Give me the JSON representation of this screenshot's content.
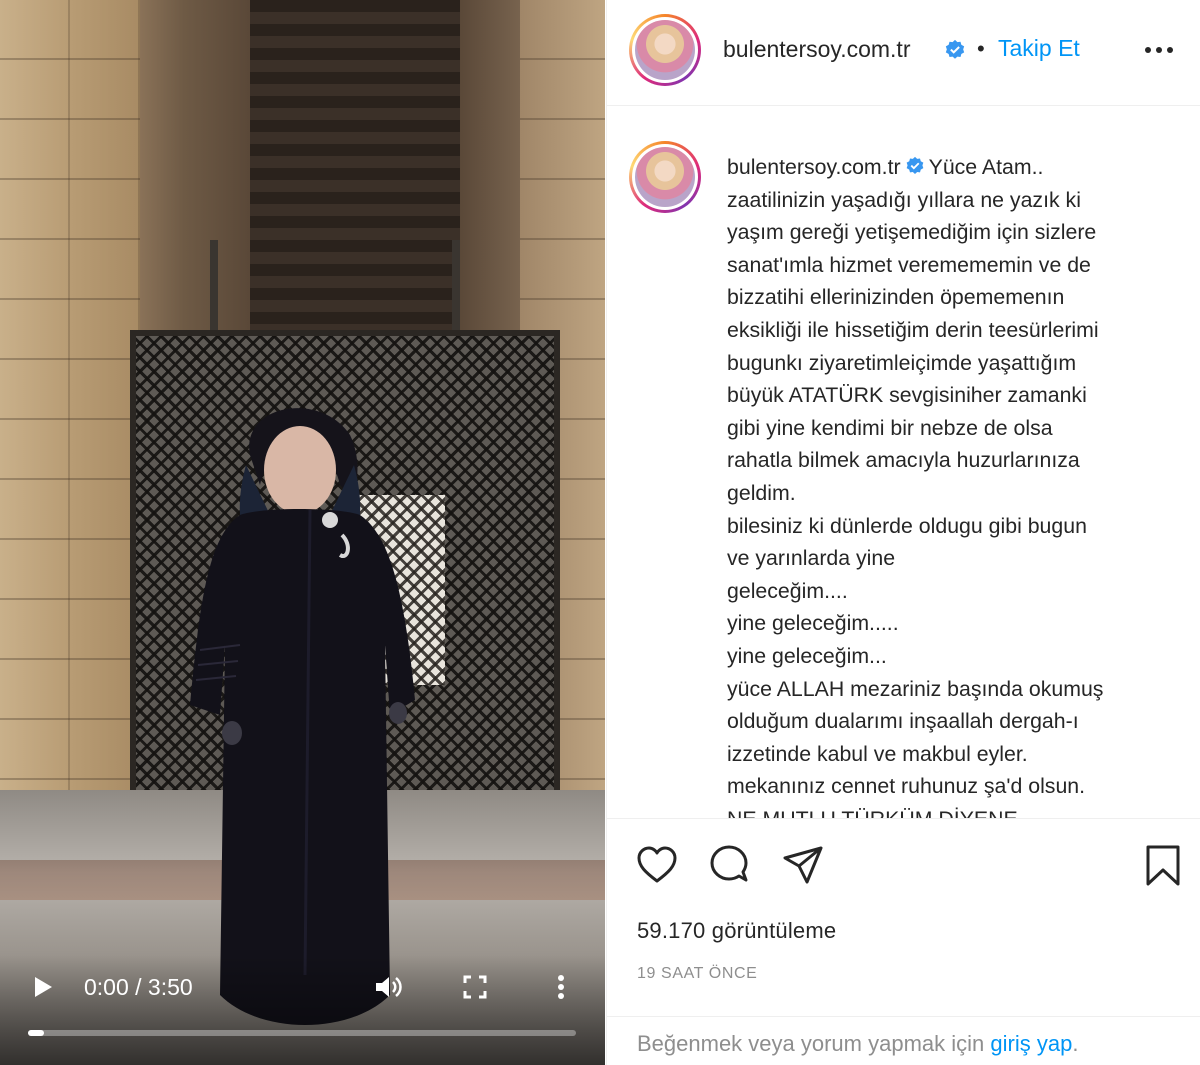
{
  "video": {
    "time_display": "0:00 / 3:50",
    "progress_fraction": 0.03,
    "icons": {
      "play": "play-icon",
      "volume": "volume-icon",
      "fullscreen": "fullscreen-icon",
      "more": "more-vertical-icon"
    }
  },
  "post": {
    "username": "bulentersoy.com.tr",
    "verified": true,
    "follow_separator": "•",
    "follow_label": "Takip Et",
    "caption": {
      "first_line": "Yüce Atam..",
      "body": "zaatilinizin yaşadığı yıllara ne yazık ki\nyaşım gereği yetişemediğim için sizlere\nsanat'ımla hizmet veremememin ve de\nbizzatihi ellerinizinden öpememenın\neksikliği ile hissetiğim derin teesürlerimi\nbugunkı ziyaretimleiçimde yaşattığım\nbüyük ATATÜRK sevgisiniher zamanki\ngibi yine kendimi bir nebze de olsa\nrahatla bilmek amacıyla huzurlarınıza\ngeldim.\nbilesiniz ki dünlerde oldugu gibi bugun\nve yarınlarda yine\ngeleceğim....\nyine geleceğim.....\nyine geleceğim...\nyüce ALLAH mezariniz başında okumuş\nolduğum dualarımı inşaallah dergah-ı\nizzetinde kabul ve makbul eyler.\nmekanınız cennet ruhunuz şa'd olsun.\nNE MUTLU TÜRKÜM DİYENE"
    },
    "views": "59.170 görüntüleme",
    "time_ago": "19 SAAT ÖNCE",
    "login_prompt": "Beğenmek veya yorum yapmak için",
    "login_link": "giriş yap",
    "login_suffix": ".",
    "icons": {
      "like": "heart-icon",
      "comment": "comment-icon",
      "share": "share-icon",
      "save": "bookmark-icon",
      "options": "more-horizontal-icon"
    }
  }
}
